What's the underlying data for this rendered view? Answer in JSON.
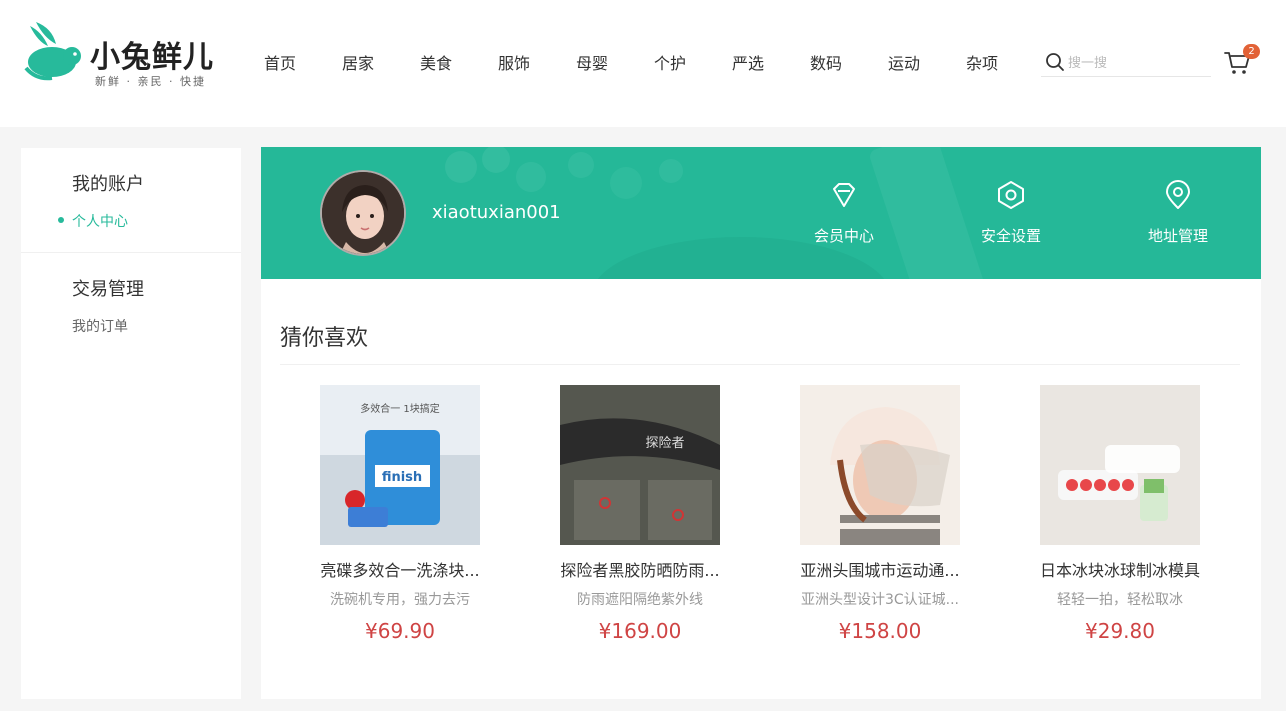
{
  "brand": {
    "name": "小兔鲜儿",
    "slogan": "新鲜 · 亲民 · 快捷"
  },
  "nav": {
    "items": [
      "首页",
      "居家",
      "美食",
      "服饰",
      "母婴",
      "个护",
      "严选",
      "数码",
      "运动",
      "杂项"
    ]
  },
  "search": {
    "placeholder": "搜一搜"
  },
  "cart": {
    "count": "2"
  },
  "sidebar": {
    "groups": [
      {
        "title": "我的账户",
        "links": [
          "个人中心"
        ]
      },
      {
        "title": "交易管理",
        "links": [
          "我的订单"
        ]
      }
    ]
  },
  "profile": {
    "username": "xiaotuxian001",
    "links": [
      {
        "label": "会员中心",
        "icon": "diamond-icon"
      },
      {
        "label": "安全设置",
        "icon": "hexagon-shield-icon"
      },
      {
        "label": "地址管理",
        "icon": "location-pin-icon"
      }
    ]
  },
  "recommend": {
    "title": "猜你喜欢",
    "goods": [
      {
        "name": "亮碟多效合一洗涤块...",
        "desc": "洗碗机专用，强力去污",
        "price": "¥69.90",
        "image_text": "多效合一 1块搞定"
      },
      {
        "name": "探险者黑胶防晒防雨...",
        "desc": "防雨遮阳隔绝紫外线",
        "price": "¥169.00",
        "image_text": "探险者"
      },
      {
        "name": "亚洲头围城市运动通...",
        "desc": "亚洲头型设计3C认证城...",
        "price": "¥158.00",
        "image_text": ""
      },
      {
        "name": "日本冰块冰球制冰模具",
        "desc": "轻轻一拍，轻松取冰",
        "price": "¥29.80",
        "image_text": ""
      }
    ]
  },
  "colors": {
    "brand_green": "#27ba9b",
    "price_red": "#cf4444",
    "badge_orange": "#e26237"
  }
}
